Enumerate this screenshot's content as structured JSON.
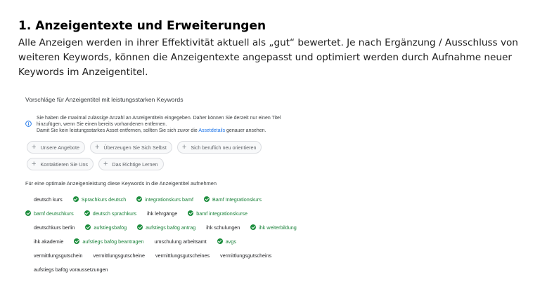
{
  "slide": {
    "title": "1. Anzeigentexte und Erweiterungen",
    "body": "Alle Anzeigen werden in ihrer Effektivität aktuell als „gut“ bewertet. Je nach Ergänzung / Ausschluss von weiteren Keywords, können die Anzeigentexte angepasst und optimiert werden durch Aufnahme neuer Keywords im Anzeigentitel."
  },
  "panel": {
    "title": "Vorschläge für Anzeigentitel mit leistungsstarken Keywords",
    "info_line1": "Sie haben die maximal zulässige Anzahl an Anzeigentiteln eingegeben. Daher können Sie derzeit nur einen Titel",
    "info_line2": "hinzufügen, wenn Sie einen bereits vorhandenen entfernen.",
    "info_line3_prefix": "Damit Sie kein leistungsstarkes Asset entfernen, sollten Sie sich zuvor die ",
    "info_link": "Assetdetails",
    "info_line3_suffix": " genauer ansehen.",
    "info_icon": "info-icon",
    "suggestion_chips": [
      "Unsere Angebote",
      "Überzeugen Sie Sich Selbst",
      "Sich beruflich neu orientieren",
      "Kontaktieren Sie Uns",
      "Das Richtige Lernen"
    ],
    "keywords_heading": "Für eine optimale Anzeigenleistung diese Keywords in die Anzeigentitel aufnehmen",
    "keywords": [
      {
        "text": "deutsch kurs",
        "added": false
      },
      {
        "text": "Sprachkurs deutsch",
        "added": true
      },
      {
        "text": "integrationskurs bamf",
        "added": true
      },
      {
        "text": "Bamf Integrationskurs",
        "added": true
      },
      {
        "text": "bamf deutschkurs",
        "added": true
      },
      {
        "text": "deutsch sprachkurs",
        "added": true
      },
      {
        "text": "ihk lehrgänge",
        "added": false
      },
      {
        "text": "bamf integrationskurse",
        "added": true
      },
      {
        "text": "deutschkurs berlin",
        "added": false
      },
      {
        "text": "aufstiegsbafög",
        "added": true
      },
      {
        "text": "aufstiegs bafög antrag",
        "added": true
      },
      {
        "text": "ihk schulungen",
        "added": false
      },
      {
        "text": "ihk weiterbildung",
        "added": true
      },
      {
        "text": "ihk akademie",
        "added": false
      },
      {
        "text": "aufstiegs bafög beantragen",
        "added": true
      },
      {
        "text": "umschulung arbeitsamt",
        "added": false
      },
      {
        "text": "avgs",
        "added": true
      },
      {
        "text": "vermittlungsgutschein",
        "added": false
      },
      {
        "text": "vermittlungsgutscheine",
        "added": false
      },
      {
        "text": "vermittlungsgutscheines",
        "added": false
      },
      {
        "text": "vermittlungsgutscheins",
        "added": false
      },
      {
        "text": "aufstiegs bafög voraussetzungen",
        "added": false
      }
    ],
    "colors": {
      "added": "#188038",
      "check": "#1e8e3e",
      "link": "#1a73e8"
    }
  }
}
